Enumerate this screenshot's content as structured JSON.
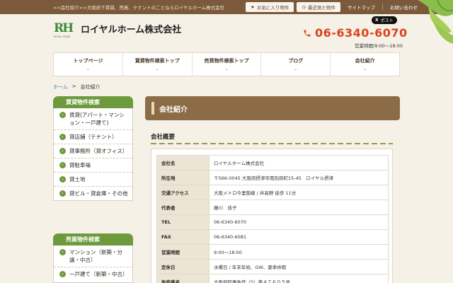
{
  "header": {
    "tagline": "<<会社紹介>>大阪府下賃貸、売買、テナントのことならロイヤルホーム株式会社",
    "favorites_label": "お気に入り物件",
    "recent_label": "最近見た物件",
    "sitemap_label": "サイトマップ",
    "contact_label": "お問い合わせ",
    "logo_mark": "RH",
    "logo_sub": "ROYAL HOME",
    "company_name": "ロイヤルホーム株式会社",
    "x_post_label": "ポスト",
    "phone": "06-6340-6070",
    "hours": "営業時間/9:00～18:00"
  },
  "nav": {
    "items": [
      {
        "label": "トップページ"
      },
      {
        "label": "賃貸物件検索トップ"
      },
      {
        "label": "売買物件検索トップ"
      },
      {
        "label": "ブログ"
      },
      {
        "label": "会社紹介"
      }
    ]
  },
  "breadcrumb": {
    "home": "ホーム",
    "separator": ">",
    "current": "会社紹介"
  },
  "sidebar": {
    "rental": {
      "title": "賃貸物件検索",
      "items": [
        {
          "label": "賃貸(アパート・マンション・一戸建て)"
        },
        {
          "label": "貸店舗（テナント）"
        },
        {
          "label": "貸事務所（貸オフィス）"
        },
        {
          "label": "貸駐車場"
        },
        {
          "label": "貸土地"
        },
        {
          "label": "貸ビル・貸倉庫・その他"
        }
      ]
    },
    "sale": {
      "title": "売買物件検索",
      "items": [
        {
          "label": "マンション（新築・分譲・中古）"
        },
        {
          "label": "一戸建て（新築・中古）"
        }
      ]
    }
  },
  "main": {
    "page_title": "会社紹介",
    "section_title": "会社概要",
    "rows": [
      {
        "key": "会社名",
        "value": "ロイヤルホーム株式会社"
      },
      {
        "key": "所在地",
        "value": "〒566-0045 大阪府摂津市南別府町15-45　ロイヤル摂津"
      },
      {
        "key": "交通アクセス",
        "value": "大阪メトロ今里筋線 / 井高野 徒歩 11分"
      },
      {
        "key": "代表者",
        "value": "藤川　佳子"
      },
      {
        "key": "TEL",
        "value": "06-6340-6070"
      },
      {
        "key": "FAX",
        "value": "06-6340-6081"
      },
      {
        "key": "営業時間",
        "value": "9:00～18:00"
      },
      {
        "key": "定休日",
        "value": "水曜日 / 年末年始、GW、夏季休暇"
      },
      {
        "key": "免許番号",
        "value": "大阪府知事免許（5）第４７６０５号"
      }
    ]
  },
  "colors": {
    "brand_green": "#6e9a3e",
    "brown": "#8c6c46",
    "phone_orange": "#d9441f"
  }
}
